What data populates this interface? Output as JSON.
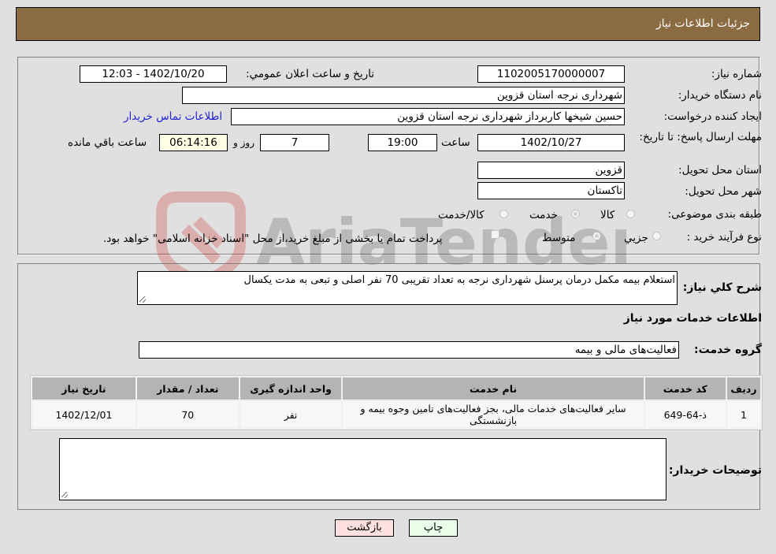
{
  "header": {
    "title": "جزئیات اطلاعات نیاز"
  },
  "form": {
    "need_number": {
      "label": "شماره نیاز:",
      "value": "1102005170000007"
    },
    "announce_datetime": {
      "label": "تاریخ و ساعت اعلان عمومي:",
      "value": "1402/10/20 - 12:03"
    },
    "buyer_org": {
      "label": "نام دستگاه خریدار:",
      "value": "شهرداری نرجه استان قزوین"
    },
    "requester": {
      "label": "ایجاد کننده درخواست:",
      "value": "حسین شیخها کاربرداز شهرداری نرجه استان قزوین"
    },
    "buyer_contact_link": "اطلاعات تماس خریدار",
    "deadline": {
      "label": "مهلت ارسال پاسخ: تا تاریخ:",
      "date": "1402/10/27",
      "time_label": "ساعت",
      "time": "19:00",
      "days": "7",
      "days_label": "روز و",
      "remaining": "06:14:16",
      "remaining_label": "ساعت باقي مانده"
    },
    "delivery_province": {
      "label": "استان محل تحویل:",
      "value": "قزوین"
    },
    "delivery_city": {
      "label": "شهر محل تحویل:",
      "value": "تاکستان"
    },
    "category": {
      "label": "طبقه بندی موضوعی:",
      "options": [
        "کالا",
        "خدمت",
        "کالا/خدمت"
      ],
      "selected": "خدمت"
    },
    "purchase_type": {
      "label": "نوع فرآیند خرید :",
      "options": [
        "جزيي",
        "متوسط"
      ],
      "selected": "متوسط",
      "treasury_note": "پرداخت تمام یا بخشی از مبلغ خرید،از محل \"اسناد خزانه اسلامی\" خواهد بود."
    }
  },
  "details": {
    "description": {
      "label": "شرح کلي نیاز:",
      "value": "استعلام بیمه مکمل درمان پرسنل شهرداری نرجه به تعداد تقریبی 70 نفر اصلی و تبعی به مدت یکسال"
    },
    "services_heading": "اطلاعات خدمات مورد نیاز",
    "service_group": {
      "label": "گروه خدمت:",
      "value": "فعالیت‌های مالی و بیمه"
    },
    "table": {
      "columns": [
        "ردیف",
        "کد خدمت",
        "نام خدمت",
        "واحد اندازه گیری",
        "تعداد / مقدار",
        "تاریخ نیاز"
      ],
      "rows": [
        {
          "row": "1",
          "code": "ذ-64-649",
          "name": "سایر فعالیت‌های خدمات مالی، بجز فعالیت‌های تامین وجوه بیمه و بازنشستگی",
          "unit": "نفر",
          "quantity": "70",
          "date": "1402/12/01"
        }
      ]
    },
    "buyer_notes": {
      "label": "توضیحات خریدار:",
      "value": ""
    }
  },
  "buttons": {
    "print": "چاپ",
    "back": "بازگشت"
  },
  "watermark": {
    "text": "AriaTender.neT"
  },
  "colors": {
    "header_bg": "#8b6c42",
    "print_bg": "#eaffea",
    "back_bg": "#ffe0e0",
    "link": "#2323d6"
  }
}
